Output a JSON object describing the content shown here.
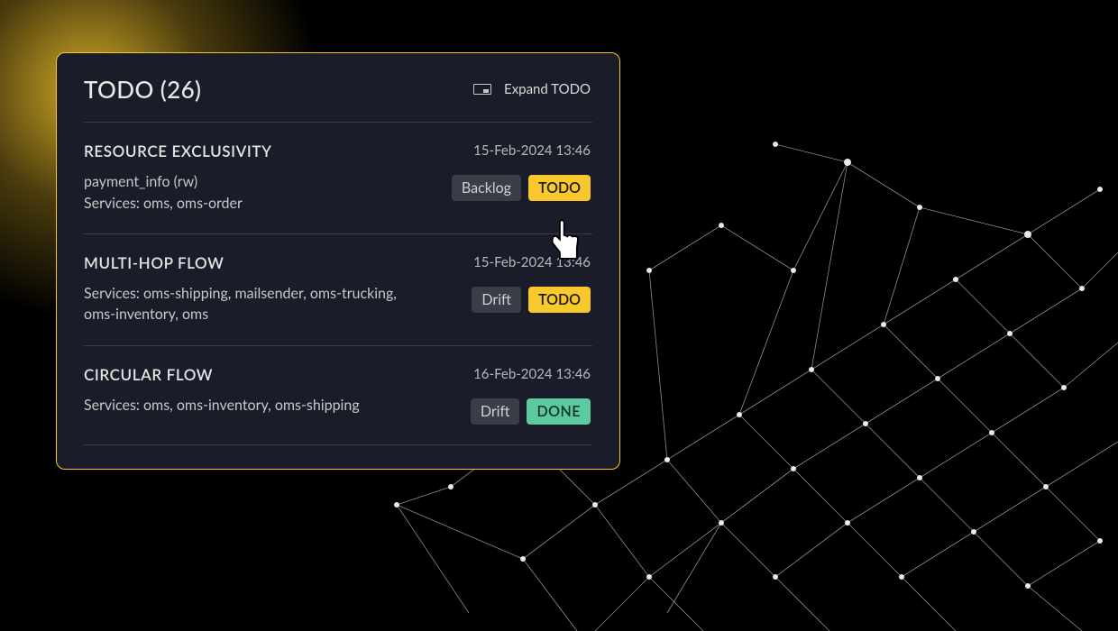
{
  "panel": {
    "title": "TODO (26)",
    "expand_label": "Expand TODO"
  },
  "items": [
    {
      "name": "RESOURCE EXCLUSIVITY",
      "timestamp": "15-Feb-2024 13:46",
      "line1": "payment_info (rw)",
      "line2": "Services: oms, oms-order",
      "tag1": "Backlog",
      "tag2": "TODO",
      "status_type": "yellow"
    },
    {
      "name": "MULTI-HOP FLOW",
      "timestamp": "15-Feb-2024 13:46",
      "line1": "Services: oms-shipping, mailsender, oms-trucking, oms-inventory, oms",
      "line2": "",
      "tag1": "Drift",
      "tag2": "TODO",
      "status_type": "yellow"
    },
    {
      "name": "CIRCULAR FLOW",
      "timestamp": "16-Feb-2024 13:46",
      "line1": "Services: oms, oms-inventory, oms-shipping",
      "line2": "",
      "tag1": "Drift",
      "tag2": "DONE",
      "status_type": "green"
    }
  ],
  "colors": {
    "accent": "#f8c82d",
    "done": "#5dc9a0",
    "panel_bg": "#1a1d29",
    "tag_grey": "#3a3d48"
  }
}
